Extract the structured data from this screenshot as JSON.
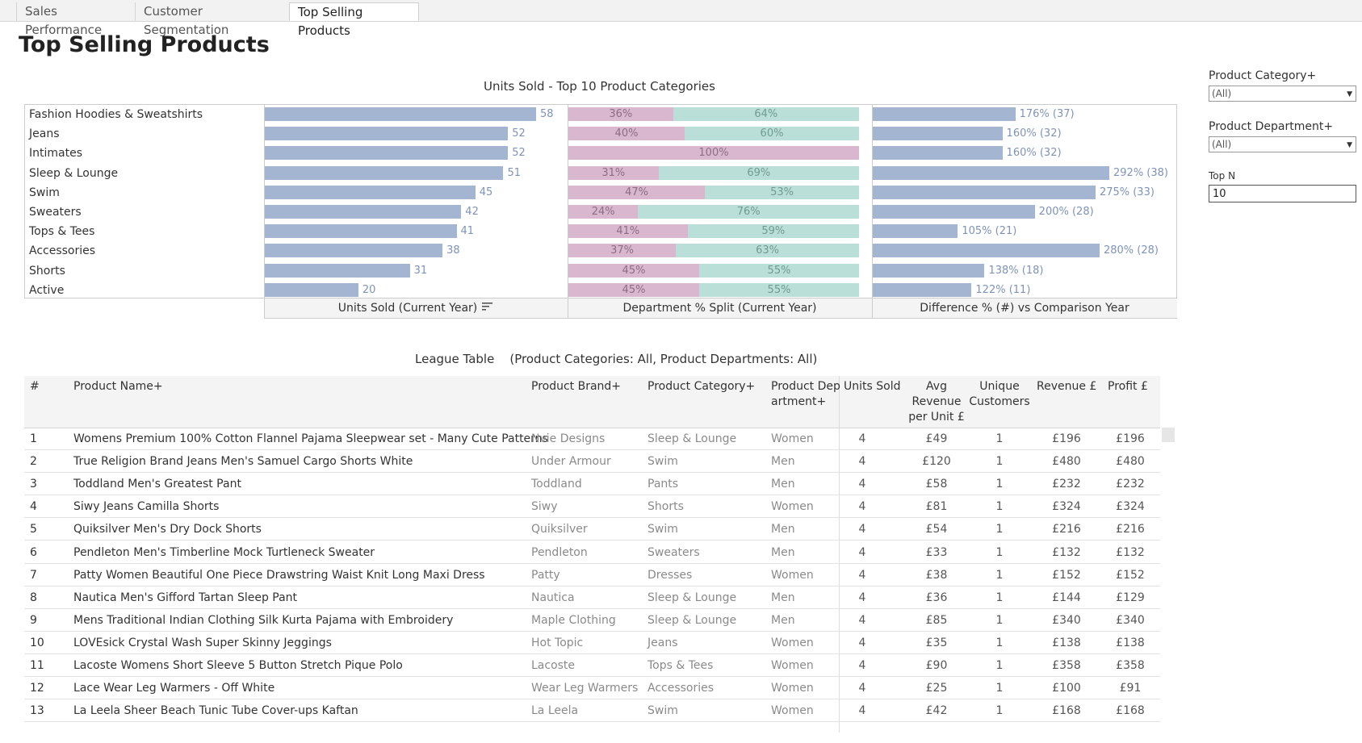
{
  "tabs": [
    {
      "label": "Sales Performance",
      "active": false
    },
    {
      "label": "Customer Segmentation",
      "active": false
    },
    {
      "label": "Top Selling Products",
      "active": true
    }
  ],
  "page_title": "Top Selling Products",
  "chart_data": {
    "type": "bar",
    "title": "Units Sold - Top 10 Product Categories",
    "categories": [
      "Fashion Hoodies & Sweatshirts",
      "Jeans",
      "Intimates",
      "Sleep & Lounge",
      "Swim",
      "Sweaters",
      "Tops & Tees",
      "Accessories",
      "Shorts",
      "Active"
    ],
    "units_sold": {
      "axis_title": "Units Sold (Current Year)",
      "values": [
        58,
        52,
        52,
        51,
        45,
        42,
        41,
        38,
        31,
        20
      ]
    },
    "department_split": {
      "axis_title": "Department % Split (Current Year)",
      "women_pct": [
        36,
        40,
        100,
        31,
        47,
        24,
        41,
        37,
        45,
        45
      ],
      "men_pct": [
        64,
        60,
        0,
        69,
        53,
        76,
        59,
        63,
        55,
        55
      ],
      "colors": {
        "women": "#d9b8cf",
        "men": "#badfd8"
      }
    },
    "difference": {
      "axis_title": "Difference % (#) vs Comparison Year",
      "pct": [
        176,
        160,
        160,
        292,
        275,
        200,
        105,
        280,
        138,
        122
      ],
      "count": [
        37,
        32,
        32,
        38,
        33,
        28,
        21,
        28,
        18,
        11
      ],
      "labels": [
        "176% (37)",
        "160% (32)",
        "160% (32)",
        "292% (38)",
        "275% (33)",
        "200% (28)",
        "105% (21)",
        "280% (28)",
        "138% (18)",
        "122% (11)"
      ]
    },
    "bar_color": "#a3b5d1"
  },
  "league": {
    "title": "League Table",
    "subtitle": "(Product Categories: All, Product Departments: All)",
    "headers": {
      "rank": "#",
      "name": "Product Name+",
      "brand": "Product Brand+",
      "category": "Product Category+",
      "dept_line1": "Product Dep",
      "dept_line2": "artment+",
      "units": "Units Sold",
      "avg_line1": "Avg",
      "avg_line2": "Revenue",
      "avg_line3": "per Unit £",
      "cust_line1": "Unique",
      "cust_line2": "Customers",
      "revenue": "Revenue £",
      "profit": "Profit £"
    },
    "rows": [
      [
        "1",
        "Womens Premium 100% Cotton Flannel Pajama Sleepwear set - Many Cute Patterns",
        "Nvie Designs",
        "Sleep & Lounge",
        "Women",
        "4",
        "£49",
        "1",
        "£196",
        "£196"
      ],
      [
        "2",
        "True Religion Brand Jeans Men's Samuel Cargo Shorts White",
        "Under Armour",
        "Swim",
        "Men",
        "4",
        "£120",
        "1",
        "£480",
        "£480"
      ],
      [
        "3",
        "Toddland Men's Greatest Pant",
        "Toddland",
        "Pants",
        "Men",
        "4",
        "£58",
        "1",
        "£232",
        "£232"
      ],
      [
        "4",
        "Siwy Jeans Camilla Shorts",
        "Siwy",
        "Shorts",
        "Women",
        "4",
        "£81",
        "1",
        "£324",
        "£324"
      ],
      [
        "5",
        "Quiksilver Men's Dry Dock Shorts",
        "Quiksilver",
        "Swim",
        "Men",
        "4",
        "£54",
        "1",
        "£216",
        "£216"
      ],
      [
        "6",
        "Pendleton Men's Timberline Mock Turtleneck Sweater",
        "Pendleton",
        "Sweaters",
        "Men",
        "4",
        "£33",
        "1",
        "£132",
        "£132"
      ],
      [
        "7",
        "Patty Women Beautiful One Piece Drawstring Waist Knit Long Maxi Dress",
        "Patty",
        "Dresses",
        "Women",
        "4",
        "£38",
        "1",
        "£152",
        "£152"
      ],
      [
        "8",
        "Nautica Men's Gifford Tartan Sleep Pant",
        "Nautica",
        "Sleep & Lounge",
        "Men",
        "4",
        "£36",
        "1",
        "£144",
        "£129"
      ],
      [
        "9",
        "Mens Traditional Indian Clothing Silk Kurta Pajama with Embroidery",
        "Maple Clothing",
        "Sleep & Lounge",
        "Men",
        "4",
        "£85",
        "1",
        "£340",
        "£340"
      ],
      [
        "10",
        "LOVEsick Crystal Wash Super Skinny Jeggings",
        "Hot Topic",
        "Jeans",
        "Women",
        "4",
        "£35",
        "1",
        "£138",
        "£138"
      ],
      [
        "11",
        "Lacoste Womens Short Sleeve 5 Button Stretch Pique Polo",
        "Lacoste",
        "Tops & Tees",
        "Women",
        "4",
        "£90",
        "1",
        "£358",
        "£358"
      ],
      [
        "12",
        "Lace Wear Leg Warmers - Off White",
        "Wear Leg Warmers",
        "Accessories",
        "Women",
        "4",
        "£25",
        "1",
        "£100",
        "£91"
      ],
      [
        "13",
        "La Leela Sheer Beach Tunic Tube Cover-ups Kaftan",
        "La Leela",
        "Swim",
        "Women",
        "4",
        "£42",
        "1",
        "£168",
        "£168"
      ]
    ]
  },
  "filters": {
    "category_label": "Product Category+",
    "category_value": "(All)",
    "department_label": "Product Department+",
    "department_value": "(All)",
    "topn_label": "Top N",
    "topn_value": "10"
  },
  "icons": {
    "sort": "sort-descending-icon",
    "dropdown": "chevron-down-icon"
  }
}
